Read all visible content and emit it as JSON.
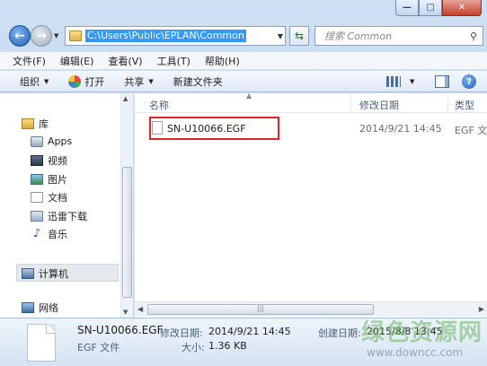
{
  "window": {
    "controls": {
      "minimize": "—",
      "maximize": "□",
      "close": "✕"
    }
  },
  "address": {
    "path": "C:\\Users\\Public\\EPLAN\\Common"
  },
  "search": {
    "placeholder": "搜索 Common"
  },
  "menu": [
    "文件(F)",
    "编辑(E)",
    "查看(V)",
    "工具(T)",
    "帮助(H)"
  ],
  "toolbar": {
    "organize": "组织",
    "open": "打开",
    "share": "共享",
    "new_folder": "新建文件夹"
  },
  "nav": {
    "library": "库",
    "items": [
      "Apps",
      "视频",
      "图片",
      "文档",
      "迅雷下载",
      "音乐"
    ],
    "computer": "计算机",
    "network": "网络"
  },
  "columns": {
    "name": "名称",
    "modified": "修改日期",
    "type": "类型"
  },
  "files": [
    {
      "name": "SN-U10066.EGF",
      "modified": "2014/9/21 14:45",
      "type": "EGF 文件"
    }
  ],
  "details": {
    "name": "SN-U10066.EGF",
    "type": "EGF 文件",
    "modified_label": "修改日期:",
    "modified": "2014/9/21 14:45",
    "size_label": "大小:",
    "size": "1.36 KB",
    "created_label": "创建日期:",
    "created": "2015/8/8 13:45"
  },
  "watermark": {
    "logo": "绿色资源网",
    "url": "www.downcc.com"
  },
  "icons": {
    "back": "back-arrow-icon",
    "forward": "forward-arrow-icon",
    "folder": "folder-icon",
    "refresh": "refresh-icon",
    "search": "search-icon",
    "open": "open-icon",
    "help": "help-icon"
  },
  "colors": {
    "selection": "#3399ff",
    "highlight_box": "#d9262c",
    "close_button": "#c2402c"
  }
}
